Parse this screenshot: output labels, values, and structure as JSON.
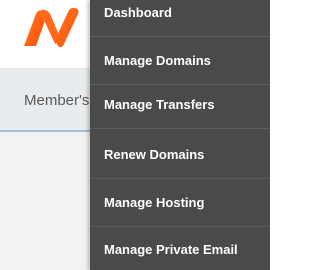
{
  "header": {
    "logo_icon": "namecheap-logo-icon",
    "brand_color": "#ff5a14"
  },
  "subnav": {
    "label": "Member's"
  },
  "menu": {
    "background": "#4a4a4a",
    "items": [
      {
        "label": "Dashboard"
      },
      {
        "label": "Manage Domains"
      },
      {
        "label": "Manage Transfers"
      },
      {
        "label": "Renew Domains"
      },
      {
        "label": "Manage Hosting"
      },
      {
        "label": "Manage Private Email"
      }
    ]
  }
}
